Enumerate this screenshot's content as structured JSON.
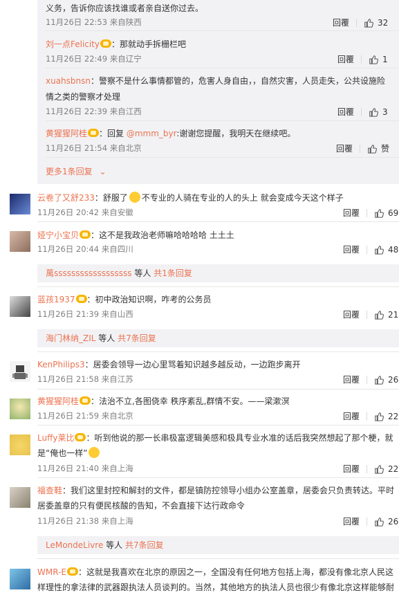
{
  "sub_replies_1": [
    {
      "name": "",
      "text": "义务，告诉你应该找谁或者亲自送你过去。",
      "time": "11月26日 22:53 来自陕西",
      "likes": "32"
    },
    {
      "name": "刘一点Felicity",
      "text": "：那就动手拆栅栏吧",
      "time": "11月26日 22:49 来自辽宁",
      "likes": "1"
    },
    {
      "name": "xuahsbnsn",
      "text": "：警察不是什么事情都管的，危害人身自由，，自然灾害，人员走失，公共设施险",
      "text2": "情之类的警察才处理",
      "time": "11月26日 22:39 来自江西",
      "likes": "3"
    },
    {
      "name": "黄猩猩阿桂",
      "text": "：回复 ",
      "mention": "@mmm_byr",
      "text_after": ":谢谢您提醒，我明天在继续吧。",
      "time": "11月26日 21:54 来自北京",
      "likes": "赞"
    }
  ],
  "more_replies_1": "更多1条回复",
  "reply_label": "回覆",
  "comments": [
    {
      "name": "云卷了又舒233",
      "text_before": "：舒服了",
      "text_after": "不专业的人骑在专业的人的头上 就会变成今天这个样子",
      "time": "11月26日 20:42 来自安徽",
      "likes": "69"
    },
    {
      "name": "娅宁小宝贝",
      "text": "：这不是我政治老师嘛哈哈哈哈 土土土",
      "time": "11月26日 20:44 来自四川",
      "likes": "48"
    },
    {
      "name": "蓝孩1937",
      "text": "：初中政治知识啊，咋考的公务员",
      "time": "11月26日 21:39 来自山西",
      "likes": "21"
    },
    {
      "name": "KenPhilips3",
      "text": "：居委会领导一边心里骂着知识越多越反动，一边跑步离开",
      "time": "11月26日 21:58 来自江苏",
      "likes": "26"
    },
    {
      "name": "黄猩猩阿桂",
      "text": "：法治不立,各图侥幸 秩序紊乱,群情不安。——梁漱溟",
      "time": "11月26日 21:59 来自北京",
      "likes": "22"
    },
    {
      "name": "Luffy莱比",
      "text": "：听到他说的那一长串极富逻辑美感和极具专业水准的话后我突然想起了那个梗，就",
      "text2": "是“俺也一样”",
      "time": "11月26日 21:40 来自上海",
      "likes": "22"
    },
    {
      "name": "福查鞋",
      "text": "：我们这里封控和解封的文件，都是镇防控领导小组办公室盖章，居委会只负责转达。平时",
      "text2": "居委盖章的只有便民核酸的告知，不会直接下达行政命令",
      "time": "11月26日 21:38 来自上海",
      "likes": "26"
    },
    {
      "name": "WMR-E",
      "text": "：这就是我喜欢在北京的原因之一，全国没有任何地方包括上海，都没有像北京人民这",
      "text2": "样理性的拿法律的武器跟执法人员谈判的。当然，其他地方的执法人员也很少有像北京这样能够耐"
    }
  ],
  "reply_summaries": [
    {
      "name": "萬ssssssssssssssssss",
      "middle": " 等人 ",
      "count": "共1条回复"
    },
    {
      "name": "海门林纳_ZIL",
      "middle": " 等人 ",
      "count": "共7条回复"
    },
    {
      "name": "LeMondeLivre",
      "middle": " 等人 ",
      "count": "共7条回复"
    }
  ],
  "colors": {
    "accent": "#eb7350",
    "link": "#eb7350",
    "bg_sub": "#f2f2f5"
  }
}
